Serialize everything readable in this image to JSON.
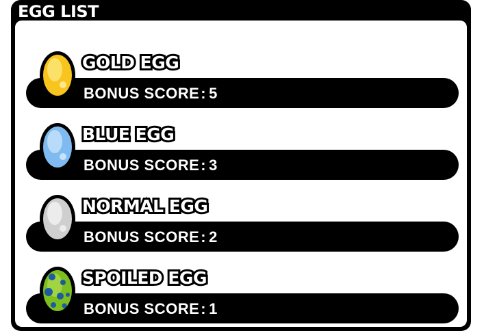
{
  "panel": {
    "title": "EGG LIST"
  },
  "eggs": [
    {
      "name": "GOLD EGG",
      "bonus_label": "BONUS SCORE",
      "bonus_value": "5",
      "icon": "gold-egg-icon",
      "colors": {
        "fill": "#f7c51e",
        "light": "#fde77a",
        "dark": "#d99a0a"
      }
    },
    {
      "name": "BLUE EGG",
      "bonus_label": "BONUS SCORE",
      "bonus_value": "3",
      "icon": "blue-egg-icon",
      "colors": {
        "fill": "#7fbbf0",
        "light": "#c7e3fb",
        "dark": "#4f92d6"
      }
    },
    {
      "name": "NORMAL EGG",
      "bonus_label": "BONUS SCORE",
      "bonus_value": "2",
      "icon": "normal-egg-icon",
      "colors": {
        "fill": "#cfcfcf",
        "light": "#f2f2f2",
        "dark": "#a6a6a6"
      }
    },
    {
      "name": "SPOILED EGG",
      "bonus_label": "BONUS SCORE",
      "bonus_value": "1",
      "icon": "spoiled-egg-icon",
      "colors": {
        "fill": "#7cbf1e",
        "light": "#b9e25a",
        "dark": "#1e5aa0"
      }
    }
  ]
}
